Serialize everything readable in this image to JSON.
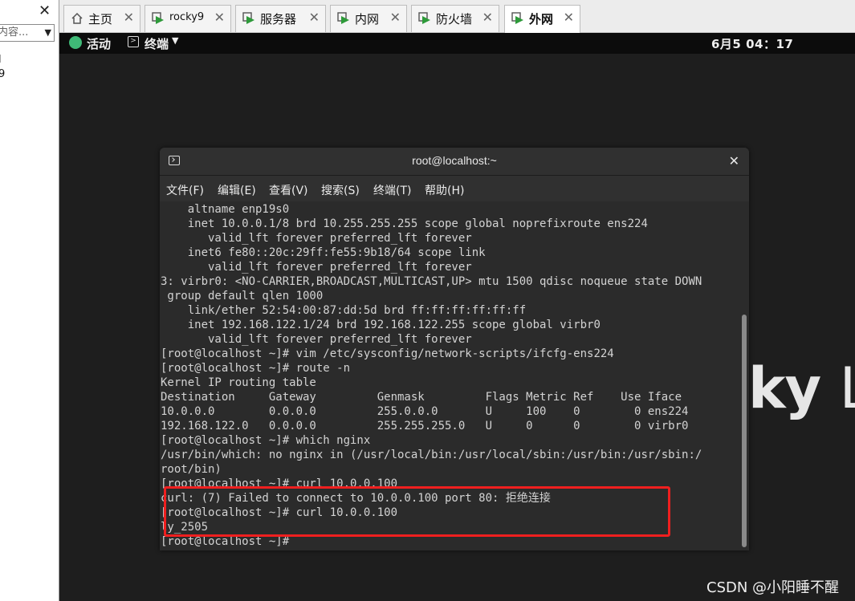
{
  "left_panel": {
    "close_glyph": "✕",
    "search_placeholder": "内容...",
    "tree_items": [
      "l",
      "9"
    ]
  },
  "tabs": [
    {
      "label": "主页",
      "icon": "home-icon",
      "active": false
    },
    {
      "label": "rocky9",
      "icon": "vm-icon",
      "active": false
    },
    {
      "label": "服务器",
      "icon": "vm-icon",
      "active": false
    },
    {
      "label": "内网",
      "icon": "vm-icon",
      "active": false
    },
    {
      "label": "防火墙",
      "icon": "vm-icon",
      "active": false
    },
    {
      "label": "外网",
      "icon": "vm-icon",
      "active": true
    }
  ],
  "gnome_bar": {
    "activities": "活动",
    "terminal_menu": "终端",
    "clock": "6月5 04：17"
  },
  "wallpaper": {
    "bold": "ky",
    "thin": "Lin"
  },
  "terminal": {
    "title": "root@localhost:~",
    "menu": [
      "文件(F)",
      "编辑(E)",
      "查看(V)",
      "搜索(S)",
      "终端(T)",
      "帮助(H)"
    ],
    "lines": [
      "    altname enp19s0",
      "    inet 10.0.0.1/8 brd 10.255.255.255 scope global noprefixroute ens224",
      "       valid_lft forever preferred_lft forever",
      "    inet6 fe80::20c:29ff:fe55:9b18/64 scope link",
      "       valid_lft forever preferred_lft forever",
      "3: virbr0: <NO-CARRIER,BROADCAST,MULTICAST,UP> mtu 1500 qdisc noqueue state DOWN",
      " group default qlen 1000",
      "    link/ether 52:54:00:87:dd:5d brd ff:ff:ff:ff:ff:ff",
      "    inet 192.168.122.1/24 brd 192.168.122.255 scope global virbr0",
      "       valid_lft forever preferred_lft forever",
      "[root@localhost ~]# vim /etc/sysconfig/network-scripts/ifcfg-ens224",
      "[root@localhost ~]# route -n",
      "Kernel IP routing table",
      "Destination     Gateway         Genmask         Flags Metric Ref    Use Iface",
      "10.0.0.0        0.0.0.0         255.0.0.0       U     100    0        0 ens224",
      "192.168.122.0   0.0.0.0         255.255.255.0   U     0      0        0 virbr0",
      "[root@localhost ~]# which nginx",
      "/usr/bin/which: no nginx in (/usr/local/bin:/usr/local/sbin:/usr/bin:/usr/sbin:/",
      "root/bin)",
      "[root@localhost ~]# curl 10.0.0.100",
      "curl: (7) Failed to connect to 10.0.0.100 port 80: 拒绝连接",
      "[root@localhost ~]# curl 10.0.0.100",
      "ly_2505",
      "[root@localhost ~]# "
    ]
  },
  "watermark": "CSDN @小阳睡不醒",
  "colors": {
    "highlight": "#ef1f1f",
    "terminal_bg": "#2b2b2b",
    "activities_accent": "#3fba77"
  }
}
